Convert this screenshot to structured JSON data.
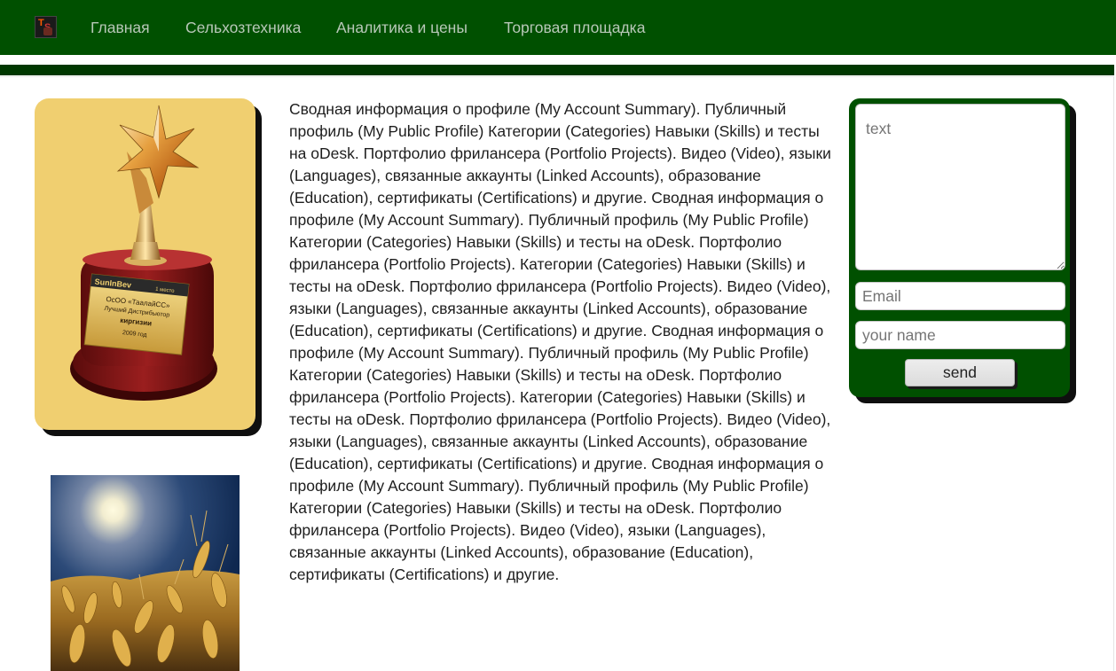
{
  "header": {
    "logo": {
      "icon": "ts-logo-icon",
      "letter_1": "T",
      "letter_2": "S"
    },
    "nav": [
      {
        "label": "Главная"
      },
      {
        "label": "Сельхозтехника"
      },
      {
        "label": "Аналитика и цены"
      },
      {
        "label": "Торговая площадка"
      }
    ]
  },
  "left": {
    "trophy_plate": {
      "brand": "SunInBev",
      "place": "1 место",
      "line1": "ОсОО «ТаалайСС»",
      "line2": "Лучший Дистрибьютор",
      "line3": "киргизии",
      "year": "2009 год"
    },
    "wheat_photo": {
      "icon": "wheat-field-photo"
    }
  },
  "main": {
    "body_text": "Сводная информация о профиле (My Account Summary). Публичный профиль (My Public Profile) Категории (Categories) Навыки (Skills) и тесты на oDesk. Портфолио фрилансера (Portfolio Projects). Видео (Video), языки (Languages), связанные аккаунты (Linked Accounts), образование (Education), сертификаты (Certifications) и другие. Сводная информация о профиле (My Account Summary). Публичный профиль (My Public Profile) Категории (Categories) Навыки (Skills) и тесты на oDesk. Портфолио фрилансера (Portfolio Projects). Категории (Categories) Навыки (Skills) и тесты на oDesk. Портфолио фрилансера (Portfolio Projects). Видео (Video), языки (Languages), связанные аккаунты (Linked Accounts), образование (Education), сертификаты (Certifications) и другие. Сводная информация о профиле (My Account Summary). Публичный профиль (My Public Profile) Категории (Categories) Навыки (Skills) и тесты на oDesk. Портфолио фрилансера (Portfolio Projects). Категории (Categories) Навыки (Skills) и тесты на oDesk. Портфолио фрилансера (Portfolio Projects). Видео (Video), языки (Languages), связанные аккаунты (Linked Accounts), образование (Education), сертификаты (Certifications) и другие. Сводная информация о профиле (My Account Summary). Публичный профиль (My Public Profile) Категории (Categories) Навыки (Skills) и тесты на oDesk. Портфолио фрилансера (Portfolio Projects). Видео (Video), языки (Languages), связанные аккаунты (Linked Accounts), образование (Education), сертификаты (Certifications) и другие."
  },
  "contact_form": {
    "message_placeholder": "text",
    "email_placeholder": "Email",
    "name_placeholder": "your name",
    "send_label": "send"
  },
  "colors": {
    "header_green": "#005000",
    "stripe_green": "#003800",
    "card_yellow": "#f0cf70",
    "shadow": "#0f0f0f"
  }
}
